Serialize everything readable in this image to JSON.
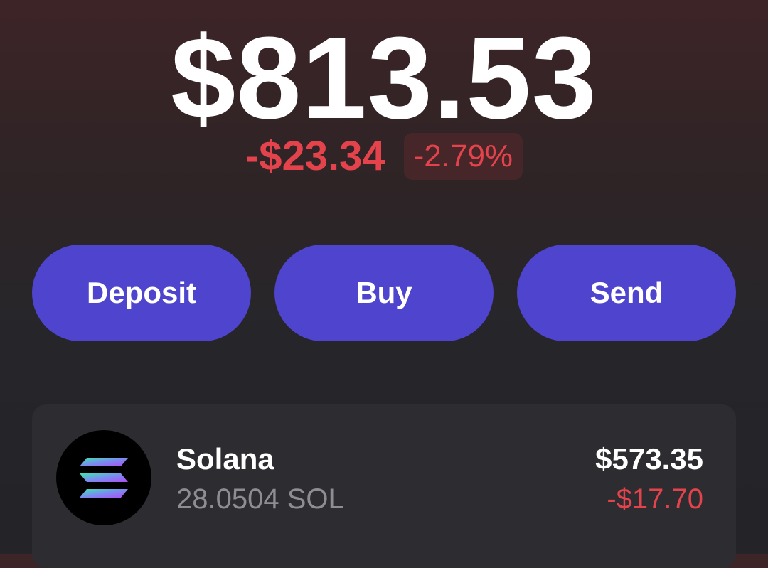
{
  "portfolio": {
    "balance": "$813.53",
    "change_amount": "-$23.34",
    "change_percent": "-2.79%",
    "negative_color": "#e5434c"
  },
  "actions": {
    "deposit_label": "Deposit",
    "buy_label": "Buy",
    "send_label": "Send",
    "button_color": "#4e44ce"
  },
  "tokens": [
    {
      "name": "Solana",
      "amount": "28.0504 SOL",
      "value": "$573.35",
      "change": "-$17.70",
      "icon": "solana-logo-icon"
    }
  ]
}
